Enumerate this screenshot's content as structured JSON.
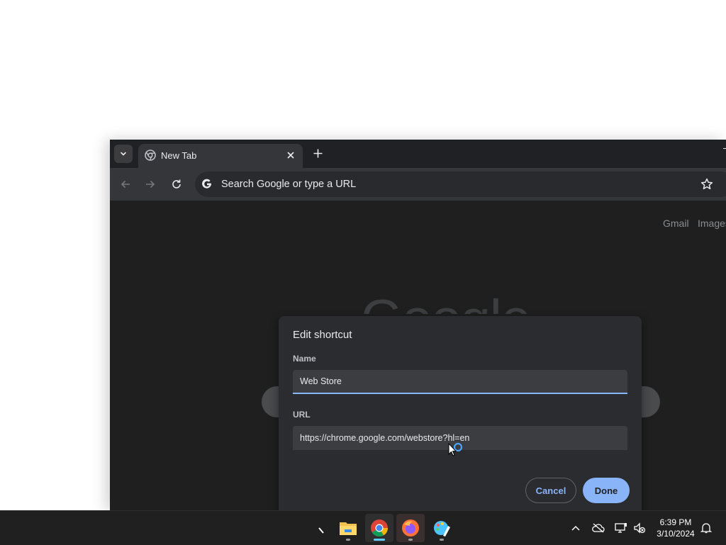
{
  "browser": {
    "tab": {
      "title": "New Tab"
    },
    "omnibox": {
      "placeholder": "Search Google or type a URL"
    },
    "top_links": [
      "Gmail",
      "Images"
    ],
    "logo_text": "Google"
  },
  "dialog": {
    "title": "Edit shortcut",
    "name_label": "Name",
    "name_value": "Web Store",
    "url_label": "URL",
    "url_value": "https://chrome.google.com/webstore?hl=en",
    "cancel_label": "Cancel",
    "done_label": "Done"
  },
  "taskbar": {
    "apps": [
      {
        "name": "file-explorer",
        "icon": "folder-icon"
      },
      {
        "name": "google-chrome",
        "icon": "chrome-icon"
      },
      {
        "name": "firefox",
        "icon": "firefox-icon"
      },
      {
        "name": "paint",
        "icon": "paint-icon"
      }
    ],
    "clock": {
      "time": "6:39 PM",
      "date": "3/10/2024"
    }
  },
  "colors": {
    "accent": "#8ab4f8",
    "window_bg": "#202124",
    "toolbar_bg": "#35363a",
    "dialog_bg": "#2b2c2f",
    "taskbar_bg": "#202020"
  }
}
